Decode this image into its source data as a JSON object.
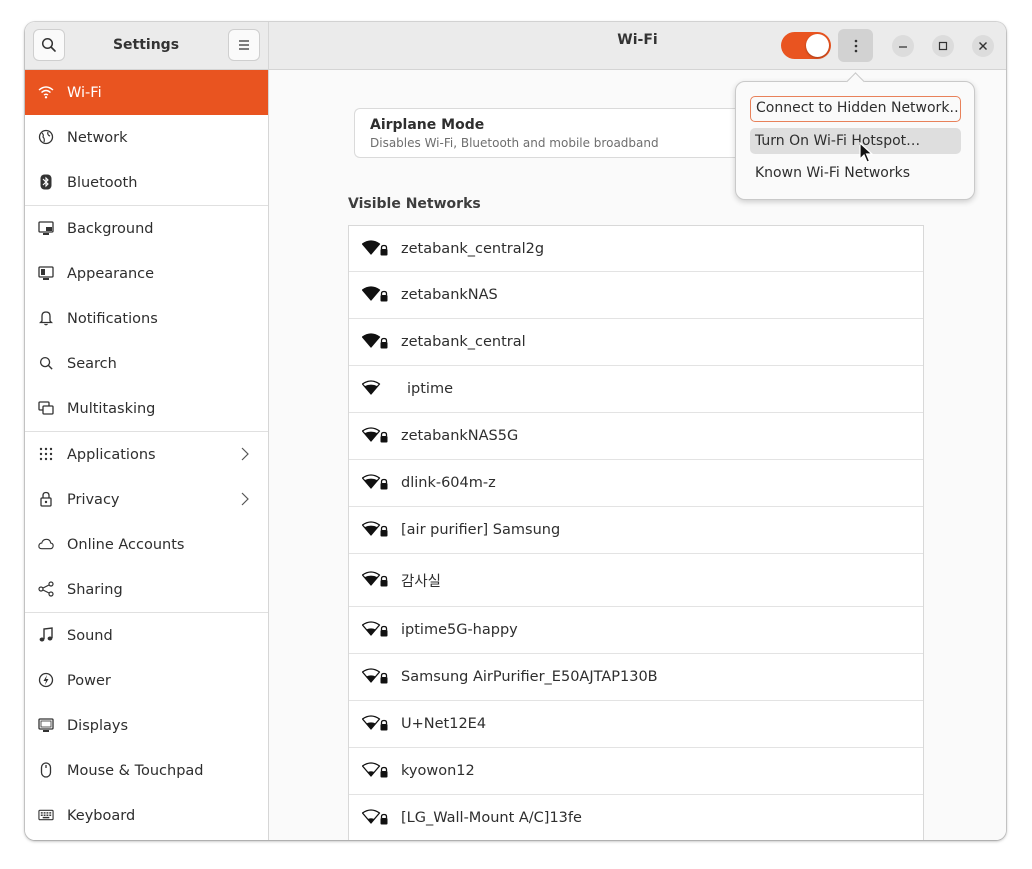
{
  "sidebar": {
    "title": "Settings",
    "items": [
      {
        "label": "Wi-Fi",
        "icon": "wifi-icon"
      },
      {
        "label": "Network",
        "icon": "globe-icon"
      },
      {
        "label": "Bluetooth",
        "icon": "bluetooth-icon"
      },
      {
        "label": "Background",
        "icon": "background-icon"
      },
      {
        "label": "Appearance",
        "icon": "appearance-icon"
      },
      {
        "label": "Notifications",
        "icon": "bell-icon"
      },
      {
        "label": "Search",
        "icon": "search-icon"
      },
      {
        "label": "Multitasking",
        "icon": "multitasking-icon"
      },
      {
        "label": "Applications",
        "icon": "grid-icon",
        "chevron": true
      },
      {
        "label": "Privacy",
        "icon": "lock-icon",
        "chevron": true
      },
      {
        "label": "Online Accounts",
        "icon": "cloud-icon"
      },
      {
        "label": "Sharing",
        "icon": "share-icon"
      },
      {
        "label": "Sound",
        "icon": "music-note-icon"
      },
      {
        "label": "Power",
        "icon": "power-icon"
      },
      {
        "label": "Displays",
        "icon": "display-icon"
      },
      {
        "label": "Mouse & Touchpad",
        "icon": "mouse-icon"
      },
      {
        "label": "Keyboard",
        "icon": "keyboard-icon"
      }
    ],
    "active_index": 0
  },
  "header": {
    "title": "Wi-Fi",
    "wifi_enabled": true
  },
  "airplane": {
    "title": "Airplane Mode",
    "subtitle": "Disables Wi-Fi, Bluetooth and mobile broadband"
  },
  "networks": {
    "heading": "Visible Networks",
    "items": [
      {
        "name": "zetabank_central2g",
        "secured": true,
        "signal": "full"
      },
      {
        "name": "zetabankNAS",
        "secured": true,
        "signal": "full"
      },
      {
        "name": "zetabank_central",
        "secured": true,
        "signal": "full"
      },
      {
        "name": "iptime",
        "secured": false,
        "signal": "good"
      },
      {
        "name": "zetabankNAS5G",
        "secured": true,
        "signal": "good"
      },
      {
        "name": "dlink-604m-z",
        "secured": true,
        "signal": "good"
      },
      {
        "name": "[air purifier] Samsung",
        "secured": true,
        "signal": "good"
      },
      {
        "name": "감사실",
        "secured": true,
        "signal": "good"
      },
      {
        "name": "iptime5G-happy",
        "secured": true,
        "signal": "weak"
      },
      {
        "name": "Samsung AirPurifier_E50AJTAP130B",
        "secured": true,
        "signal": "weak"
      },
      {
        "name": "U+Net12E4",
        "secured": true,
        "signal": "weak"
      },
      {
        "name": "kyowon12",
        "secured": true,
        "signal": "low"
      },
      {
        "name": "[LG_Wall-Mount A/C]13fe",
        "secured": true,
        "signal": "low"
      }
    ]
  },
  "popover": {
    "items": [
      {
        "label": "Connect to Hidden Network…"
      },
      {
        "label": "Turn On Wi-Fi Hotspot…"
      },
      {
        "label": "Known Wi-Fi Networks"
      }
    ]
  },
  "colors": {
    "accent": "#e95420",
    "sidebar_bg": "#ffffff",
    "headerbar_bg": "#ebebeb",
    "content_bg": "#fafafa"
  }
}
